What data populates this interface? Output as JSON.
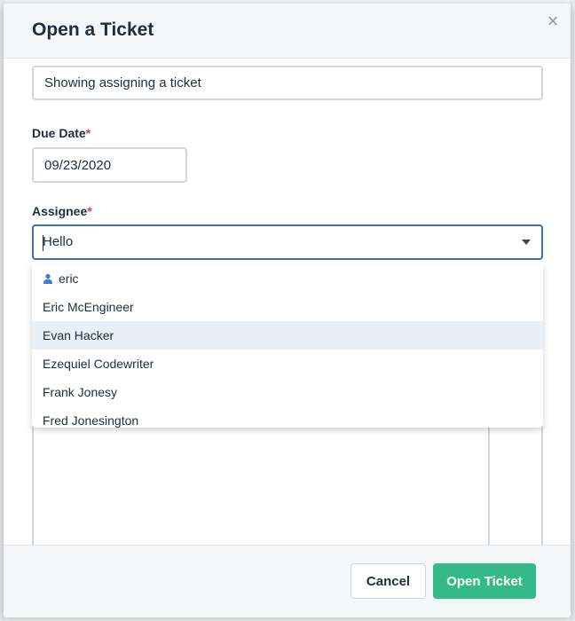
{
  "modal": {
    "title": "Open a Ticket",
    "close_icon": "close-icon",
    "close_glyph": "×"
  },
  "form": {
    "subject_value": "Showing assigning a ticket",
    "due_date_label": "Due Date",
    "due_date_value": "09/23/2020",
    "assignee_label": "Assignee",
    "assignee_value": "Hello",
    "required_marker": "*"
  },
  "dropdown": {
    "options": [
      {
        "label": "eric",
        "icon": "user-icon"
      },
      {
        "label": "Eric McEngineer"
      },
      {
        "label": "Evan Hacker",
        "highlighted": true
      },
      {
        "label": "Ezequiel Codewriter"
      },
      {
        "label": "Frank Jonesy"
      },
      {
        "label": "Fred Jonesington"
      }
    ]
  },
  "footer": {
    "cancel_label": "Cancel",
    "open_label": "Open Ticket"
  },
  "colors": {
    "primary_button": "#34b98a",
    "focus_border": "#3e6fa6",
    "required": "#e03a3a",
    "highlight_row": "#e8eff6"
  }
}
